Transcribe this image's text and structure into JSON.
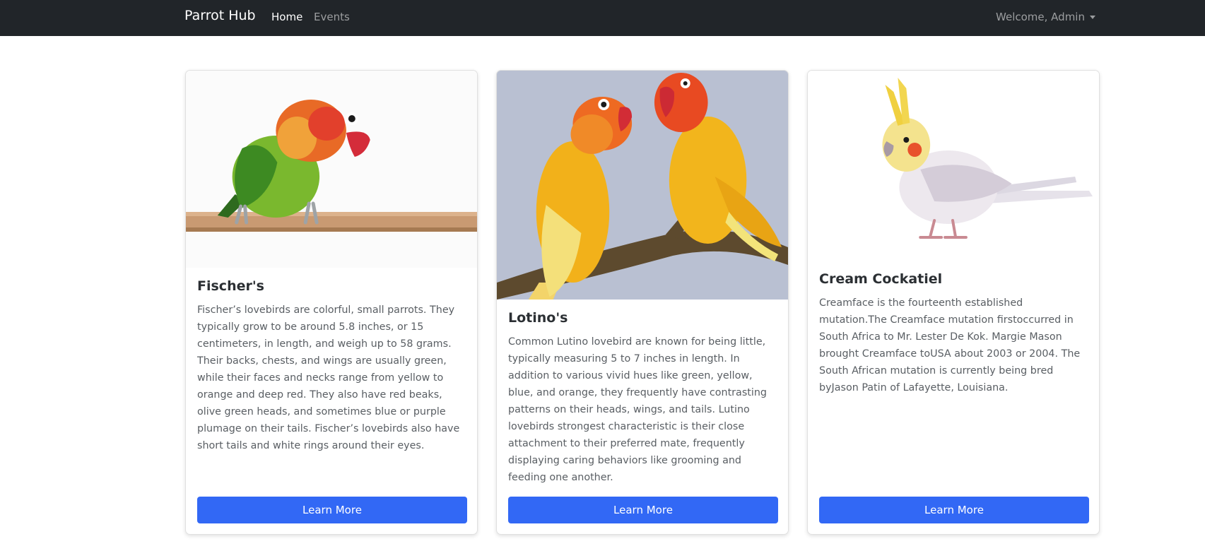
{
  "navbar": {
    "brand": "Parrot Hub",
    "links": [
      {
        "label": "Home",
        "active": true
      },
      {
        "label": "Events",
        "active": false
      }
    ],
    "user_menu": "Welcome, Admin"
  },
  "cards": [
    {
      "title": "Fischer's",
      "text": "Fischer’s lovebirds are colorful, small parrots. They typically grow to be around 5.8 inches, or 15 centimeters, in length, and weigh up to 58 grams. Their backs, chests, and wings are usually green, while their faces and necks range from yellow to orange and deep red. They also have red beaks, olive green heads, and sometimes blue or purple plumage on their tails. Fischer’s lovebirds also have short tails and white rings around their eyes.",
      "button": "Learn More",
      "image_icon": "lovebird-photo"
    },
    {
      "title": "Lotino's",
      "text": "Common Lutino lovebird are known for being little, typically measuring 5 to 7 inches in length. In addition to various vivid hues like green, yellow, blue, and orange, they frequently have contrasting patterns on their heads, wings, and tails. Lutino lovebirds strongest characteristic is their close attachment to their preferred mate, frequently displaying caring behaviors like grooming and feeding one another.",
      "button": "Learn More",
      "image_icon": "lutino-pair-photo"
    },
    {
      "title": "Cream Cockatiel",
      "text": "Creamface is the fourteenth established mutation.The Creamface mutation firstoccurred in South Africa to Mr. Lester De Kok. Margie Mason brought Creamface toUSA about 2003 or 2004. The South African mutation is currently being bred byJason Patin of Lafayette, Louisiana.",
      "button": "Learn More",
      "image_icon": "cockatiel-photo"
    }
  ],
  "colors": {
    "navbar_bg": "#212529",
    "button_bg": "#3268f5"
  }
}
